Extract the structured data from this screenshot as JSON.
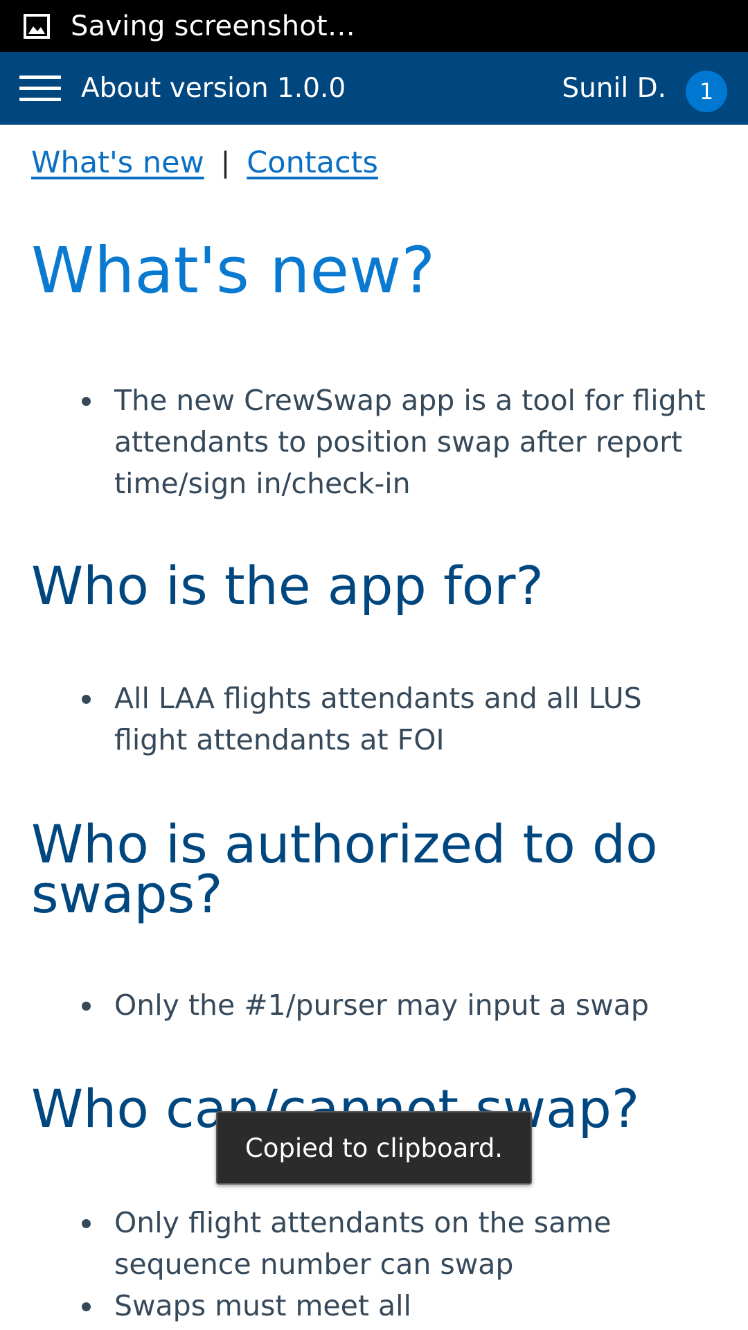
{
  "status_bar": {
    "text": "Saving screenshot…",
    "icon": "image-icon"
  },
  "header": {
    "menu_icon": "hamburger-menu-icon",
    "title": "About version 1.0.0",
    "user_name": "Sunil D.",
    "notification_count": "1"
  },
  "nav_links": {
    "whats_new": "What's new",
    "separator": "|",
    "contacts": "Contacts"
  },
  "sections": {
    "whats_new": {
      "heading": "What's new?",
      "bullets": [
        "The new CrewSwap app is a tool for flight attendants to position swap after report time/sign in/check-in"
      ]
    },
    "who_for": {
      "heading": "Who is the app for?",
      "bullets": [
        "All LAA flights attendants and all LUS flight attendants at FOI"
      ]
    },
    "who_authorized": {
      "heading": "Who is authorized to do swaps?",
      "bullets": [
        "Only the #1/purser may input a swap"
      ]
    },
    "who_can": {
      "heading": "Who can/cannot swap?",
      "bullets": [
        "Only flight attendants on the same sequence number can swap",
        "Swaps must meet all"
      ]
    }
  },
  "toast": {
    "text": "Copied to clipboard."
  },
  "colors": {
    "header_bg": "#00467f",
    "link": "#0a6fc2",
    "main_heading": "#0a7ad0",
    "section_heading": "#00467f",
    "body_text": "#36495a",
    "badge": "#0078d2"
  }
}
